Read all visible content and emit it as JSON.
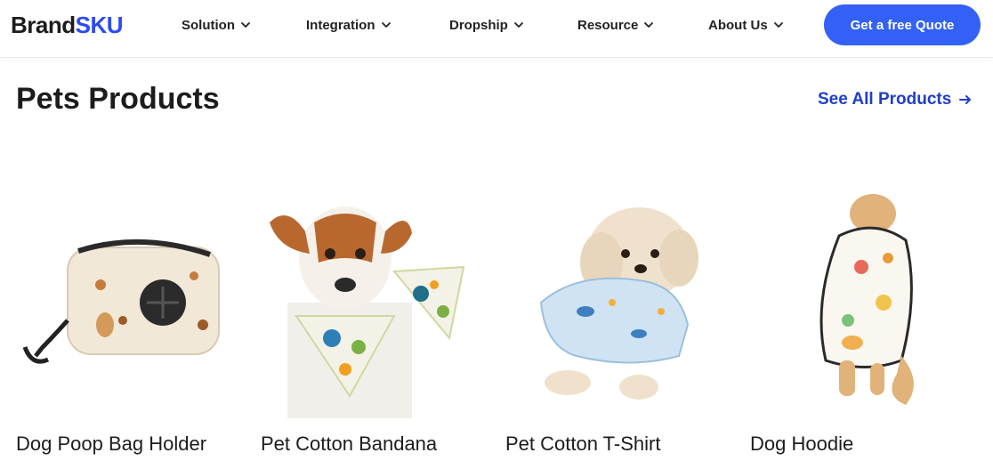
{
  "header": {
    "logo": {
      "brand": "Brand",
      "sku": "SKU"
    },
    "nav": [
      {
        "label": "Solution",
        "icon": "chevron-down-icon"
      },
      {
        "label": "Integration",
        "icon": "chevron-down-icon"
      },
      {
        "label": "Dropship",
        "icon": "chevron-down-icon"
      },
      {
        "label": "Resource",
        "icon": "chevron-down-icon"
      },
      {
        "label": "About Us",
        "icon": "chevron-down-icon"
      }
    ],
    "cta_label": "Get a free Quote"
  },
  "section": {
    "title": "Pets Products",
    "see_all_label": "See All Products",
    "see_all_icon": "arrow-right-icon"
  },
  "products": [
    {
      "name": "Dog Poop Bag Holder"
    },
    {
      "name": "Pet Cotton Bandana"
    },
    {
      "name": "Pet Cotton T-Shirt"
    },
    {
      "name": "Dog Hoodie"
    }
  ],
  "colors": {
    "accent": "#3361f5",
    "link": "#1f3fc9",
    "logo_sku": "#2c4bf2"
  }
}
